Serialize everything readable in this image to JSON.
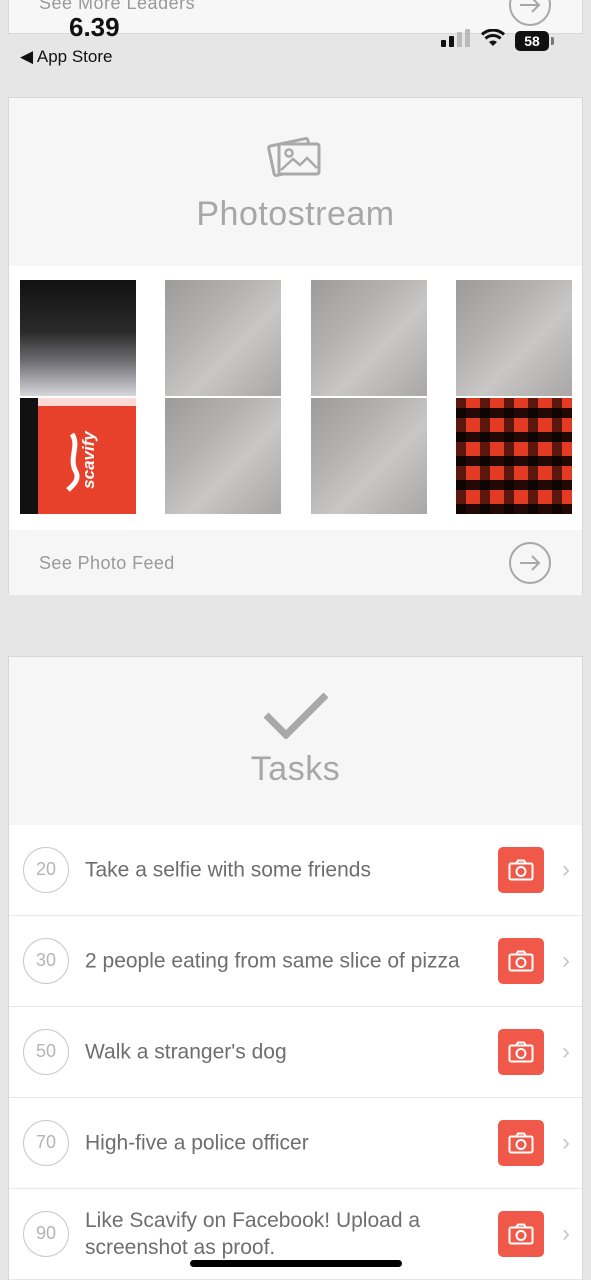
{
  "status_bar": {
    "time": "6.39",
    "back_label": "◀ App Store",
    "battery": "58"
  },
  "leaders": {
    "see_more_label": "See More Leaders"
  },
  "photostream": {
    "title": "Photostream",
    "see_feed_label": "See Photo Feed",
    "photos": [
      {
        "kind": "keyboard"
      },
      {
        "kind": "gray"
      },
      {
        "kind": "gray"
      },
      {
        "kind": "gray"
      },
      {
        "kind": "scavify",
        "text": "scavify"
      },
      {
        "kind": "gray"
      },
      {
        "kind": "gray"
      },
      {
        "kind": "plaid"
      }
    ]
  },
  "tasks": {
    "title": "Tasks",
    "items": [
      {
        "points": "20",
        "text": "Take a selfie with some friends"
      },
      {
        "points": "30",
        "text": "2 people eating from same slice of pizza"
      },
      {
        "points": "50",
        "text": "Walk a stranger's dog"
      },
      {
        "points": "70",
        "text": "High-five a police officer"
      },
      {
        "points": "90",
        "text": "Like Scavify on Facebook! Upload a screenshot as proof."
      }
    ]
  },
  "colors": {
    "accent": "#f0584a",
    "background": "#e6e6e6",
    "muted_text": "#a7a7a7"
  },
  "icons": {
    "photo": "images-icon",
    "tasks": "checkmark-icon",
    "arrow": "arrow-circle-right-icon",
    "camera": "camera-icon",
    "chevron": "chevron-right-icon"
  }
}
